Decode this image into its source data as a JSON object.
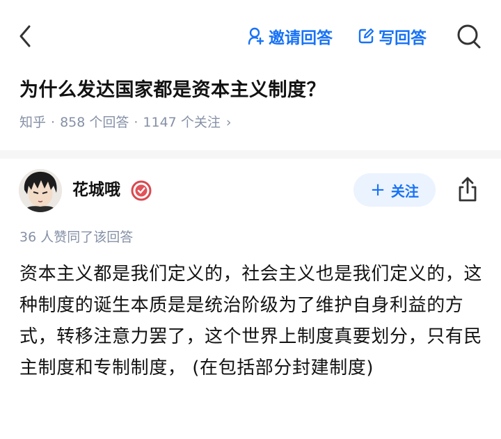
{
  "nav": {
    "invite_label": "邀请回答",
    "write_label": "写回答",
    "accent_color": "#1772f6",
    "icons": [
      "back-arrow-icon",
      "person-plus-icon",
      "pencil-square-icon",
      "search-icon"
    ]
  },
  "question": {
    "title": "为什么发达国家都是资本主义制度？",
    "source": "知乎",
    "answer_count": "858 个回答",
    "follow_count": "1147 个关注",
    "chevron": "›"
  },
  "answer": {
    "author_name": "花城哦",
    "follow_label": "关注",
    "like_text": "36 人赞同了该回答",
    "body": "资本主义都是我们定义的，社会主义也是我们定义的，这种制度的诞生本质是是统治阶级为了维护自身利益的方式，转移注意力罢了，这个世界上制度真要划分，只有民主制度和专制制度， (在包括部分封建制度)",
    "icons": [
      "avatar",
      "verified-badge-icon",
      "share-icon"
    ]
  }
}
